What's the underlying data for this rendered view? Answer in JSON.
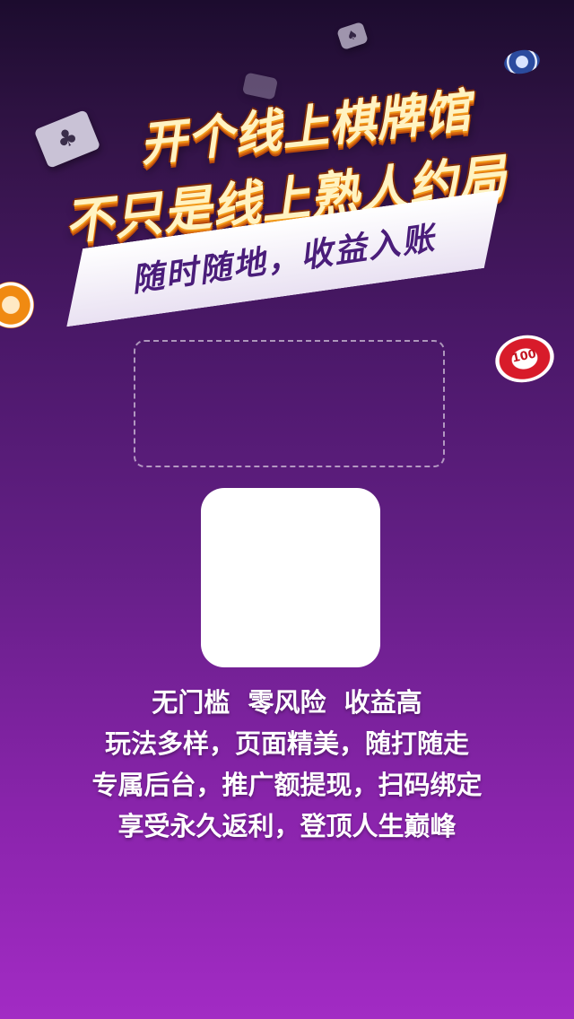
{
  "headline": {
    "line1": "开个线上棋牌馆",
    "line2": "不只是线上熟人约局",
    "ribbon": "随时随地，收益入账"
  },
  "features": [
    "无门槛  零风险  收益高",
    "玩法多样，页面精美，随打随走",
    "专属后台，推广额提现，扫码绑定",
    "享受永久返利，登顶人生巅峰"
  ],
  "chips": {
    "right_chip_value": "100"
  },
  "colors": {
    "bg_top": "#1c0c2e",
    "bg_bottom": "#a22bc4",
    "headline_fill": "#fff3c2",
    "headline_edge": "#d86a10",
    "ribbon_text": "#4a1d7a"
  }
}
